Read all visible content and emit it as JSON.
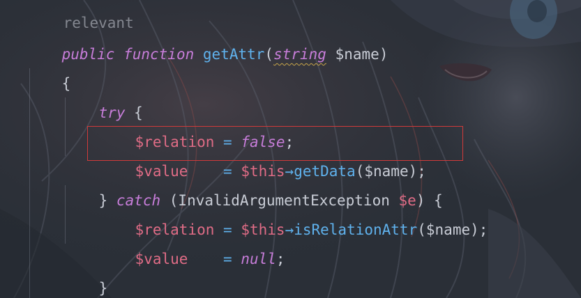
{
  "code": {
    "top_partial": "relevant",
    "line1": {
      "kw_public": "public",
      "kw_function": "function",
      "fn_name": "getAttr",
      "open_paren": "(",
      "type": "string",
      "param": "$name",
      "close_paren": ")"
    },
    "line2": {
      "brace": "{"
    },
    "line3": {
      "kw_try": "try",
      "brace": "{"
    },
    "line4": {
      "var": "$relation",
      "eq": "=",
      "value": "false",
      "semi": ";"
    },
    "line5": {
      "var": "$value",
      "eq": "=",
      "this": "$this",
      "arrow": "→",
      "method": "getData",
      "open_paren": "(",
      "arg": "$name",
      "close": ");"
    },
    "line6": {
      "close_brace": "}",
      "kw_catch": "catch",
      "open_paren": "(",
      "exception": "InvalidArgumentException",
      "var": "$e",
      "close": ") {"
    },
    "line7": {
      "var": "$relation",
      "eq": "=",
      "this": "$this",
      "arrow": "→",
      "method": "isRelationAttr",
      "open_paren": "(",
      "arg": "$name",
      "close": ");"
    },
    "line8": {
      "var": "$value",
      "eq": "=",
      "value": "null",
      "semi": ";"
    },
    "line9": {
      "close_brace": "}"
    }
  },
  "colors": {
    "background": "#2b3038",
    "keyword": "#c77dd9",
    "function": "#5fb1ec",
    "variable": "#e06c86",
    "text": "#c9cdd6",
    "highlight_border": "#d13a3a"
  }
}
